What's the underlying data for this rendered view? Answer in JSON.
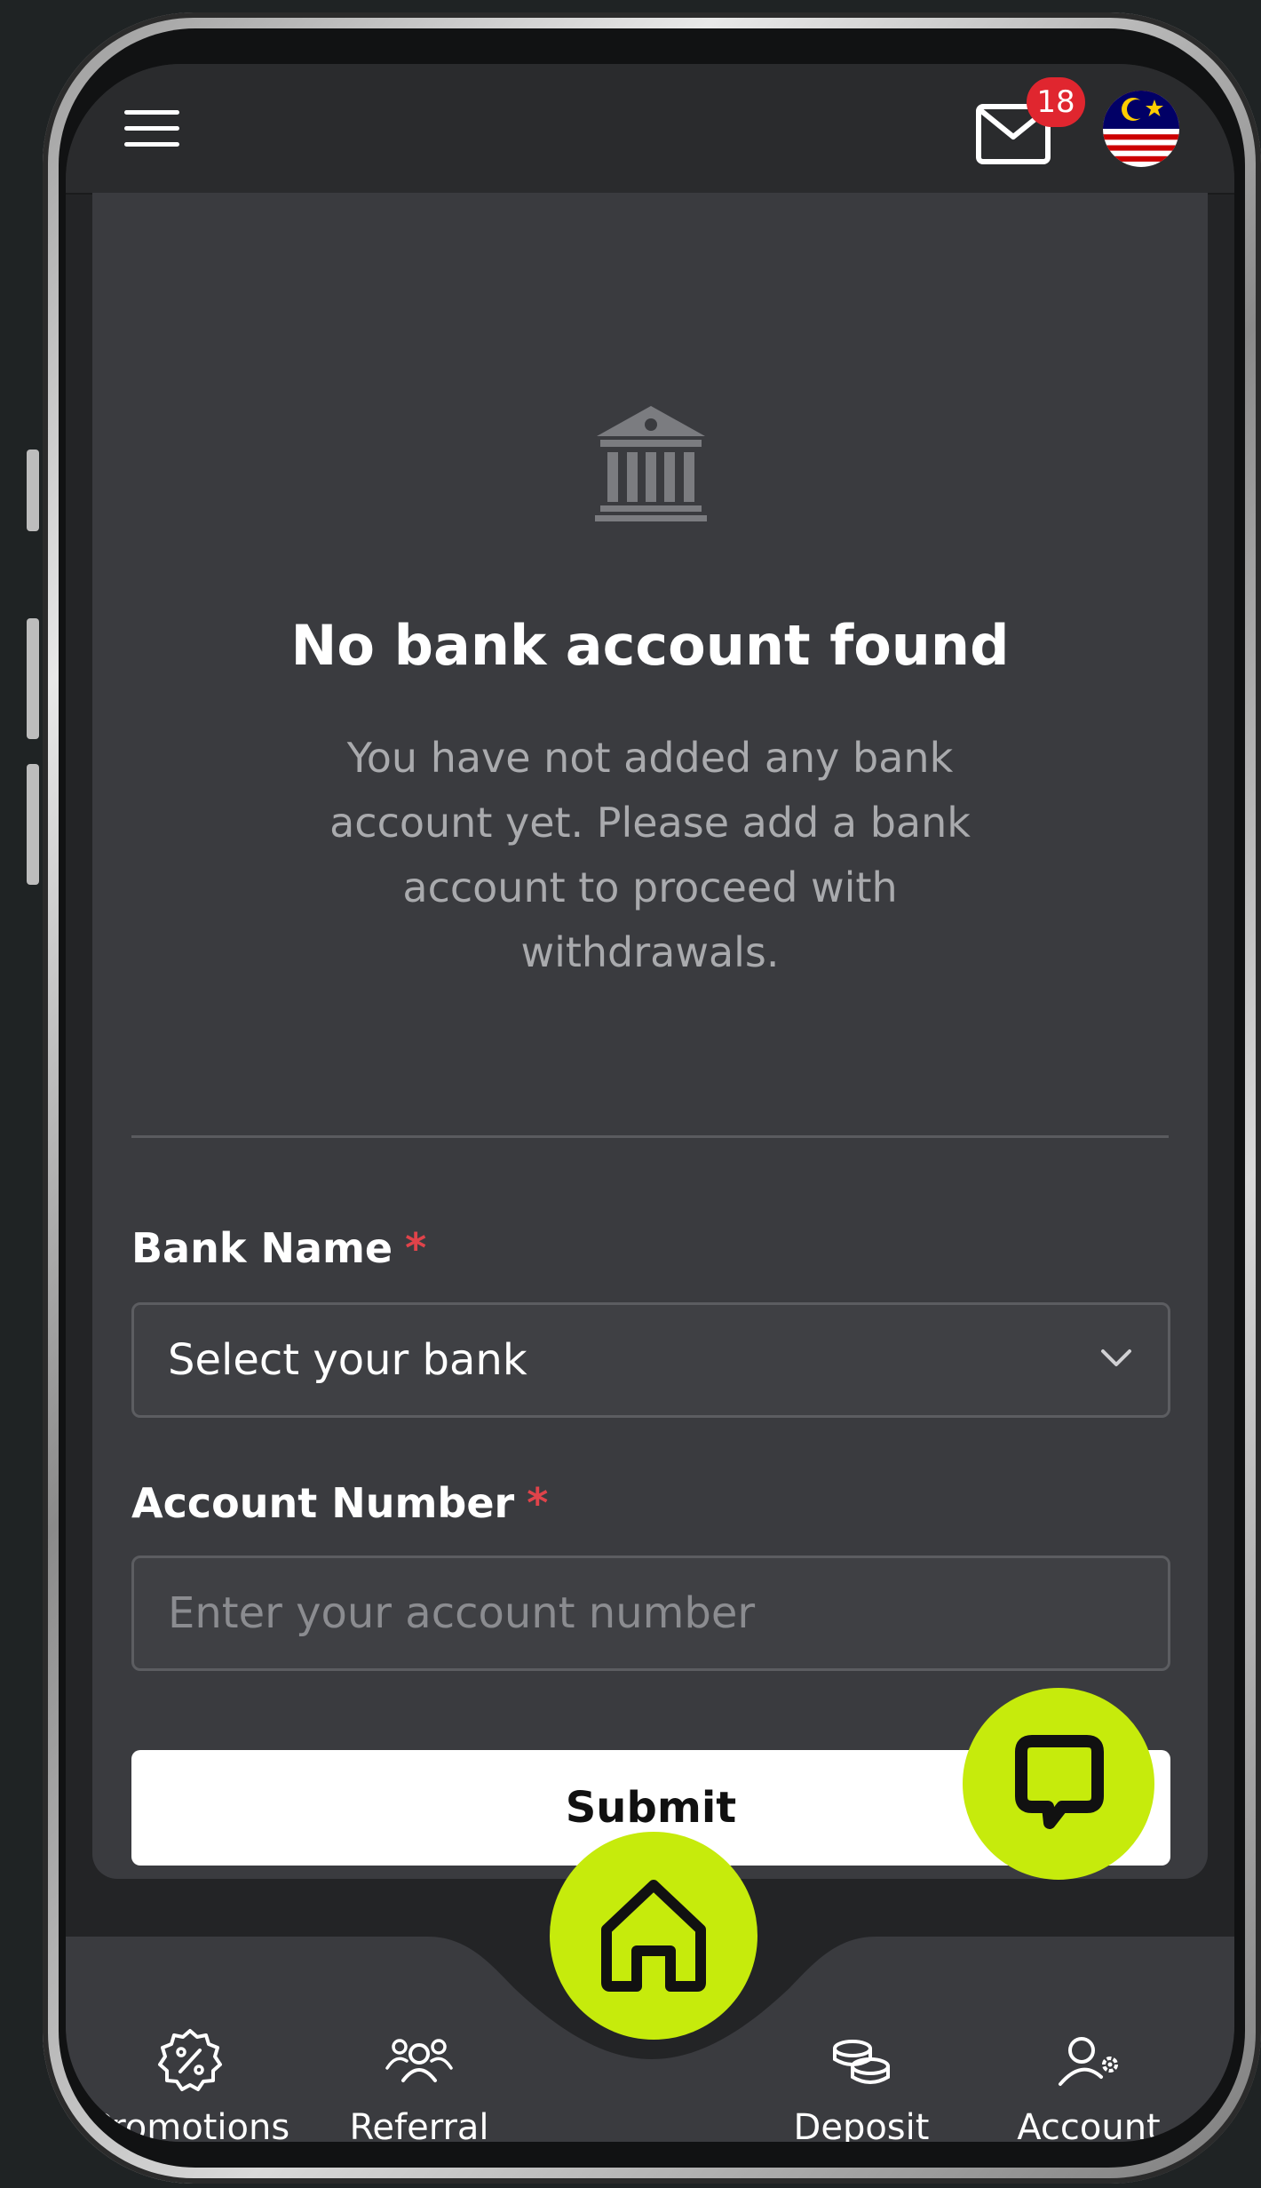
{
  "header": {
    "menu_icon": "hamburger-icon",
    "mail_icon": "mail-icon",
    "unread_count": "18",
    "language_flag": "malaysia-flag-icon"
  },
  "empty_state": {
    "icon": "bank-icon",
    "title": "No bank account found",
    "description": "You have not added any bank account yet. Please add a bank account to proceed with withdrawals."
  },
  "form": {
    "bank_name_label": "Bank Name",
    "bank_name_value": "Select your bank",
    "account_number_label": "Account Number",
    "account_number_placeholder": "Enter your account number",
    "required_mark": "*",
    "submit_label": "Submit"
  },
  "bottom_nav": {
    "items": [
      {
        "label": "Promotions",
        "icon": "percent-badge-icon"
      },
      {
        "label": "Referral",
        "icon": "users-icon"
      },
      {
        "label": "Deposit",
        "icon": "coins-icon"
      },
      {
        "label": "Account",
        "icon": "user-settings-icon"
      }
    ],
    "home_icon": "home-icon"
  },
  "colors": {
    "accent": "#c6eb0c",
    "badge": "#e0262f",
    "card_bg": "#3a3b3f",
    "header_bg": "#2a2b2d"
  }
}
